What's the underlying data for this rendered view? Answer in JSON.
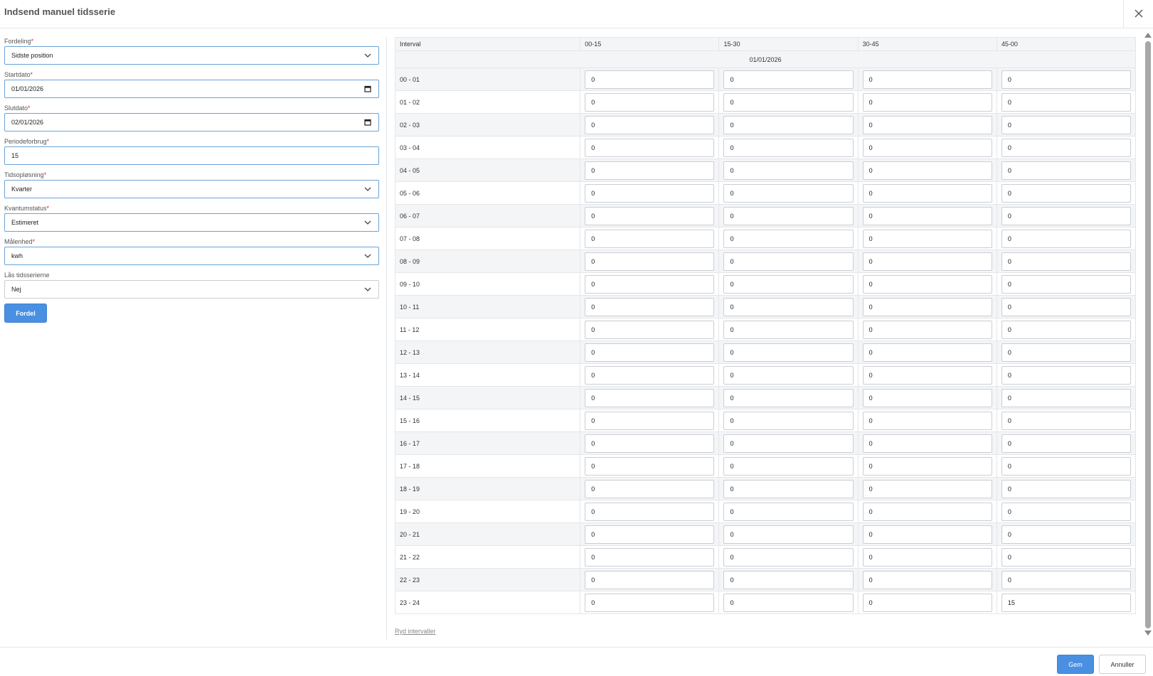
{
  "dialog": {
    "title": "Indsend manuel tidsserie",
    "close_icon": "close-icon"
  },
  "form": {
    "fields": [
      {
        "label": "Fordeling",
        "required": true,
        "value": "Sidste position",
        "kind": "select"
      },
      {
        "label": "Startdato",
        "required": true,
        "value": "01/01/2026",
        "kind": "date"
      },
      {
        "label": "Slutdato",
        "required": true,
        "value": "02/01/2026",
        "kind": "date"
      },
      {
        "label": "Periodeforbrug",
        "required": true,
        "value": "15",
        "kind": "text"
      },
      {
        "label": "Tidsopløsning",
        "required": true,
        "value": "Kvarter",
        "kind": "select"
      },
      {
        "label": "Kvantumstatus",
        "required": true,
        "value": "Estimeret",
        "kind": "select"
      },
      {
        "label": "Målenhed",
        "required": true,
        "value": "kwh",
        "kind": "select"
      },
      {
        "label": "Lås tidsserierne",
        "required": false,
        "value": "Nej",
        "kind": "select"
      }
    ],
    "fordel_button": "Fordel"
  },
  "grid": {
    "headers": [
      "Interval",
      "00-15",
      "15-30",
      "30-45",
      "45-00"
    ],
    "date": "01/01/2026",
    "rows": [
      {
        "interval": "00 - 01",
        "values": [
          "0",
          "0",
          "0",
          "0"
        ]
      },
      {
        "interval": "01 - 02",
        "values": [
          "0",
          "0",
          "0",
          "0"
        ]
      },
      {
        "interval": "02 - 03",
        "values": [
          "0",
          "0",
          "0",
          "0"
        ]
      },
      {
        "interval": "03 - 04",
        "values": [
          "0",
          "0",
          "0",
          "0"
        ]
      },
      {
        "interval": "04 - 05",
        "values": [
          "0",
          "0",
          "0",
          "0"
        ]
      },
      {
        "interval": "05 - 06",
        "values": [
          "0",
          "0",
          "0",
          "0"
        ]
      },
      {
        "interval": "06 - 07",
        "values": [
          "0",
          "0",
          "0",
          "0"
        ]
      },
      {
        "interval": "07 - 08",
        "values": [
          "0",
          "0",
          "0",
          "0"
        ]
      },
      {
        "interval": "08 - 09",
        "values": [
          "0",
          "0",
          "0",
          "0"
        ]
      },
      {
        "interval": "09 - 10",
        "values": [
          "0",
          "0",
          "0",
          "0"
        ]
      },
      {
        "interval": "10 - 11",
        "values": [
          "0",
          "0",
          "0",
          "0"
        ]
      },
      {
        "interval": "11 - 12",
        "values": [
          "0",
          "0",
          "0",
          "0"
        ]
      },
      {
        "interval": "12 - 13",
        "values": [
          "0",
          "0",
          "0",
          "0"
        ]
      },
      {
        "interval": "13 - 14",
        "values": [
          "0",
          "0",
          "0",
          "0"
        ]
      },
      {
        "interval": "14 - 15",
        "values": [
          "0",
          "0",
          "0",
          "0"
        ]
      },
      {
        "interval": "15 - 16",
        "values": [
          "0",
          "0",
          "0",
          "0"
        ]
      },
      {
        "interval": "16 - 17",
        "values": [
          "0",
          "0",
          "0",
          "0"
        ]
      },
      {
        "interval": "17 - 18",
        "values": [
          "0",
          "0",
          "0",
          "0"
        ]
      },
      {
        "interval": "18 - 19",
        "values": [
          "0",
          "0",
          "0",
          "0"
        ]
      },
      {
        "interval": "19 - 20",
        "values": [
          "0",
          "0",
          "0",
          "0"
        ]
      },
      {
        "interval": "20 - 21",
        "values": [
          "0",
          "0",
          "0",
          "0"
        ]
      },
      {
        "interval": "21 - 22",
        "values": [
          "0",
          "0",
          "0",
          "0"
        ]
      },
      {
        "interval": "22 - 23",
        "values": [
          "0",
          "0",
          "0",
          "0"
        ]
      },
      {
        "interval": "23 - 24",
        "values": [
          "0",
          "0",
          "0",
          "15"
        ]
      }
    ],
    "clear_link": "Ryd intervaller"
  },
  "footer": {
    "save_button": "Gem",
    "cancel_button": "Annuller"
  },
  "colors": {
    "accent": "#4a90e2",
    "required_star": "#c0392b",
    "border": "#e3e6ea",
    "stripe": "#f4f5f7"
  }
}
